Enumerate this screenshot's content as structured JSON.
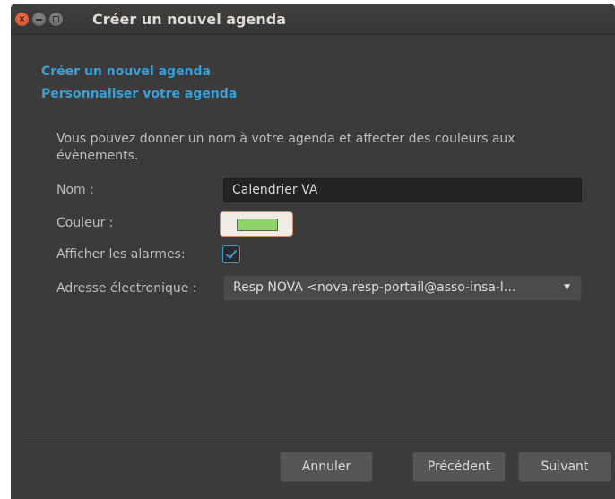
{
  "window": {
    "title": "Créer un nouvel agenda",
    "close_glyph": "×"
  },
  "steps": [
    {
      "label": "Créer un nouvel agenda"
    },
    {
      "label": "Personnaliser votre agenda"
    }
  ],
  "form": {
    "description": "Vous pouvez donner un nom à votre agenda et affecter des couleurs aux évènements.",
    "name_label": "Nom :",
    "name_value": "Calendrier VA",
    "color_label": "Couleur :",
    "color_value": "#8fd16b",
    "alarms_label": "Afficher les alarmes:",
    "alarms_checked": true,
    "email_label": "Adresse électronique :",
    "email_value": "Resp NOVA <nova.resp-portail@asso-insa-l…",
    "email_arrow": "▼"
  },
  "buttons": {
    "cancel": "Annuler",
    "previous": "Précédent",
    "next": "Suivant"
  },
  "colors": {
    "accent": "#3aa0d8",
    "background": "#3b3b3b"
  }
}
